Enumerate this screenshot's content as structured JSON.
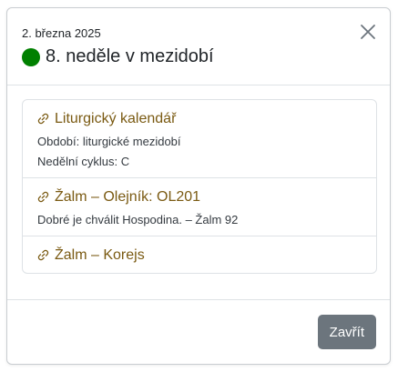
{
  "header": {
    "date": "2. března 2025",
    "title": "8. neděle v mezidobí",
    "dot_color": "#008000",
    "close_icon": "close-icon"
  },
  "items": [
    {
      "title": "Liturgický kalendář",
      "icon": "link-icon",
      "lines": [
        "Období: liturgické mezidobí",
        "Nedělní cyklus: C"
      ]
    },
    {
      "title": "Žalm – Olejník: OL201",
      "icon": "link-icon",
      "lines": [
        "Dobré je chválit Hospodina. – Žalm 92"
      ]
    },
    {
      "title": "Žalm – Korejs",
      "icon": "link-icon",
      "lines": []
    }
  ],
  "footer": {
    "close_label": "Zavřít"
  },
  "colors": {
    "link": "#7a5a12",
    "button": "#6c757d"
  }
}
